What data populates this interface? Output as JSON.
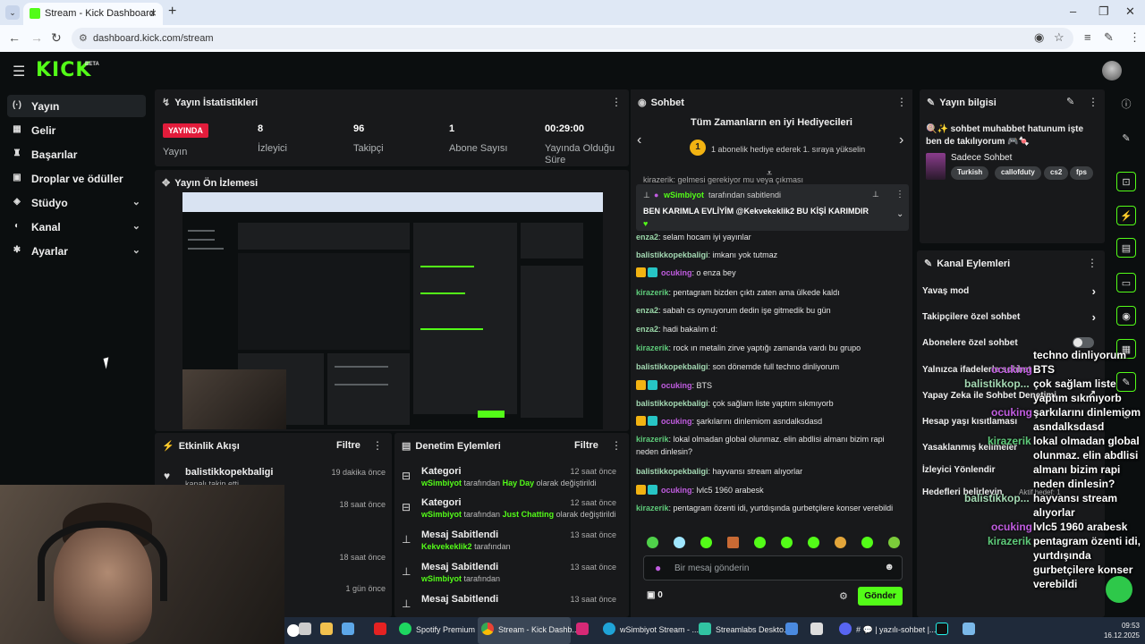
{
  "browser": {
    "tab_title": "Stream - Kick Dashboard",
    "url": "dashboard.kick.com/stream"
  },
  "header": {
    "logo": "KICK",
    "beta": "BETA"
  },
  "sidebar": {
    "items": [
      {
        "label": "Yayın",
        "icon": "broadcast-icon",
        "active": true
      },
      {
        "label": "Gelir",
        "icon": "revenue-icon"
      },
      {
        "label": "Başarılar",
        "icon": "trophy-icon"
      },
      {
        "label": "Droplar ve ödüller",
        "icon": "gift-icon"
      },
      {
        "label": "Stüdyo",
        "icon": "studio-icon",
        "expand": true
      },
      {
        "label": "Kanal",
        "icon": "channel-icon",
        "expand": true
      },
      {
        "label": "Ayarlar",
        "icon": "settings-icon",
        "expand": true
      }
    ]
  },
  "stats": {
    "title": "Yayın İstatistikleri",
    "live_badge": "YAYINDA",
    "live_label": "Yayın",
    "viewers_value": "8",
    "viewers_label": "İzleyici",
    "followers_value": "96",
    "followers_label": "Takipçi",
    "subs_value": "1",
    "subs_label": "Abone Sayısı",
    "uptime_value": "00:29:00",
    "uptime_label": "Yayında Olduğu Süre"
  },
  "preview": {
    "title": "Yayın Ön İzlemesi"
  },
  "activity": {
    "title": "Etkinlik Akışı",
    "filter": "Filtre",
    "items": [
      {
        "user": "balistikkopekbaligi",
        "sub": "kanalı takip etti",
        "time": "19 dakika önce"
      },
      {
        "time": "18 saat önce"
      },
      {
        "time": "18 saat önce"
      },
      {
        "time": "1 gün önce"
      }
    ]
  },
  "moderation": {
    "title": "Denetim Eylemleri",
    "filter": "Filtre",
    "items": [
      {
        "title": "Kategori",
        "user": "wSimbiyot",
        "pre": "tarafından",
        "value": "Hay Day",
        "post": "olarak değiştirildi",
        "time": "12 saat önce"
      },
      {
        "title": "Kategori",
        "user": "wSimbiyot",
        "pre": "tarafından",
        "value": "Just Chatting",
        "post": "olarak değiştirildi",
        "time": "12 saat önce"
      },
      {
        "title": "Mesaj Sabitlendi",
        "user": "Kekvekeklik2",
        "pre": "tarafından",
        "value": "",
        "post": "",
        "time": "13 saat önce"
      },
      {
        "title": "Mesaj Sabitlendi",
        "user": "wSimbiyot",
        "pre": "tarafından",
        "value": "",
        "post": "",
        "time": "13 saat önce"
      },
      {
        "title": "Mesaj Sabitlendi",
        "user": "",
        "pre": "",
        "value": "",
        "post": "",
        "time": "13 saat önce"
      }
    ]
  },
  "chat": {
    "title": "Sohbet",
    "gifters_title": "Tüm Zamanların en iyi Hediyecileri",
    "gifters_sub": "1 abonelik hediye ederek 1. sıraya yükselin",
    "gifters_rank": "1",
    "partial": "kirazerik: gelmesi gerekiyor mu veya çıkması",
    "pinned_by": "wSimbiyot",
    "pinned_by_suffix": "tarafından sabitlendi",
    "pinned_text": "BEN KARIMLA EVLİYİM @Kekvekeklik2 BU KİŞİ KARIMDIR",
    "messages": [
      {
        "user": "enza2",
        "color": "#9ad7a8",
        "text": "selam hocam iyi yayınlar",
        "badges": false
      },
      {
        "user": "balistikkopekbaligi",
        "color": "#a4d9b3",
        "text": "imkanı yok tutmaz",
        "badges": false
      },
      {
        "user": "ocuking",
        "color": "#c05ce0",
        "text": "o enza bey",
        "badges": true
      },
      {
        "user": "kirazerik",
        "color": "#5ecb7a",
        "text": "pentagram bizden çıktı zaten ama ülkede kaldı",
        "badges": false
      },
      {
        "user": "enza2",
        "color": "#9ad7a8",
        "text": "sabah cs oynuyorum dedin işe gitmedik bu gün",
        "badges": false
      },
      {
        "user": "enza2",
        "color": "#9ad7a8",
        "text": "hadi bakalım d:",
        "badges": false
      },
      {
        "user": "kirazerik",
        "color": "#5ecb7a",
        "text": "rock ın metalin zirve yaptığı zamanda vardı bu grupo",
        "badges": false
      },
      {
        "user": "balistikkopekbaligi",
        "color": "#a4d9b3",
        "text": "son dönemde full techno dinliyorum",
        "badges": false
      },
      {
        "user": "ocuking",
        "color": "#c05ce0",
        "text": "BTS",
        "badges": true
      },
      {
        "user": "balistikkopekbaligi",
        "color": "#a4d9b3",
        "text": "çok sağlam liste yaptım sıkmıyorb",
        "badges": false
      },
      {
        "user": "ocuking",
        "color": "#c05ce0",
        "text": "şarkılarını dinlemiom asndalksdasd",
        "badges": true
      },
      {
        "user": "kirazerik",
        "color": "#5ecb7a",
        "text": "lokal olmadan global olunmaz. elin abdlisi almanı bizim rapi neden dinlesin?",
        "badges": false
      },
      {
        "user": "balistikkopekbaligi",
        "color": "#a4d9b3",
        "text": "hayvansı stream alıyorlar",
        "badges": false
      },
      {
        "user": "ocuking",
        "color": "#c05ce0",
        "text": "lvlc5 1960 arabesk",
        "badges": true
      },
      {
        "user": "kirazerik",
        "color": "#5ecb7a",
        "text": "pentagram özenti idi, yurtdışında gurbetçilere konser verebildi",
        "badges": false
      }
    ],
    "input_placeholder": "Bir mesaj gönderin",
    "points": "0",
    "send": "Gönder"
  },
  "info": {
    "title": "Yayın bilgisi",
    "stream_title": "🍭✨ sohbet muhabbet hatunum işte ben de takılıyorum 🎮🍬",
    "category": "Sadece Sohbet",
    "tags": [
      "Turkish",
      "callofduty",
      "cs2",
      "fps"
    ]
  },
  "actions": {
    "title": "Kanal Eylemleri",
    "slow": "Yavaş mod",
    "followers_only": "Takipçilere özel sohbet",
    "subs_only": "Abonelere özel sohbet",
    "emotes_only": "Yalnızca ifadelerle sohbet",
    "ai": "Yapay Zeka ile Sohbet Denetimi",
    "age": "Hesap yaşı kısıtlaması",
    "banned": "Yasaklanmış kelimeler",
    "redirect": "İzleyici Yönlendir",
    "goals": "Hedefleri belirleyin",
    "goals_status": "Aktif hedef: 1"
  },
  "overlay": {
    "lines": [
      {
        "text": "techno dinliyorum"
      },
      {
        "user": "ocuking",
        "color": "#c05ce0",
        "text": "BTS"
      },
      {
        "user": "balistikkop...",
        "color": "#a4d9b3",
        "text": "çok sağlam liste"
      },
      {
        "text": "yaptım sıkmıyorb"
      },
      {
        "user": "ocuking",
        "color": "#c05ce0",
        "text": "şarkılarını dinlemiom"
      },
      {
        "text": "asndalksdasd"
      },
      {
        "user": "kirazerik",
        "color": "#5ecb7a",
        "text": "lokal olmadan global"
      },
      {
        "text": "olunmaz. elin abdlisi"
      },
      {
        "text": "almanı bizim rapi"
      },
      {
        "text": "neden dinlesin?"
      },
      {
        "user": "balistikkop...",
        "color": "#a4d9b3",
        "text": "hayvansı stream"
      },
      {
        "text": "alıyorlar"
      },
      {
        "user": "ocuking",
        "color": "#c05ce0",
        "text": "lvlc5 1960 arabesk"
      },
      {
        "user": "kirazerik",
        "color": "#5ecb7a",
        "text": "pentagram özenti idi,"
      },
      {
        "text": "yurtdışında"
      },
      {
        "text": "gurbetçilere konser"
      },
      {
        "text": "verebildi"
      }
    ]
  },
  "taskbar": {
    "spotify": "Spotify Premium",
    "chrome": "Stream - Kick Dashb...",
    "edge": "wSimbiyot Stream - ...",
    "streamlabs": "Streamlabs Deskto...",
    "discord": "# 💬 | yazılı-sohbet |...",
    "time": "09:53",
    "date": "16.12.2025"
  }
}
